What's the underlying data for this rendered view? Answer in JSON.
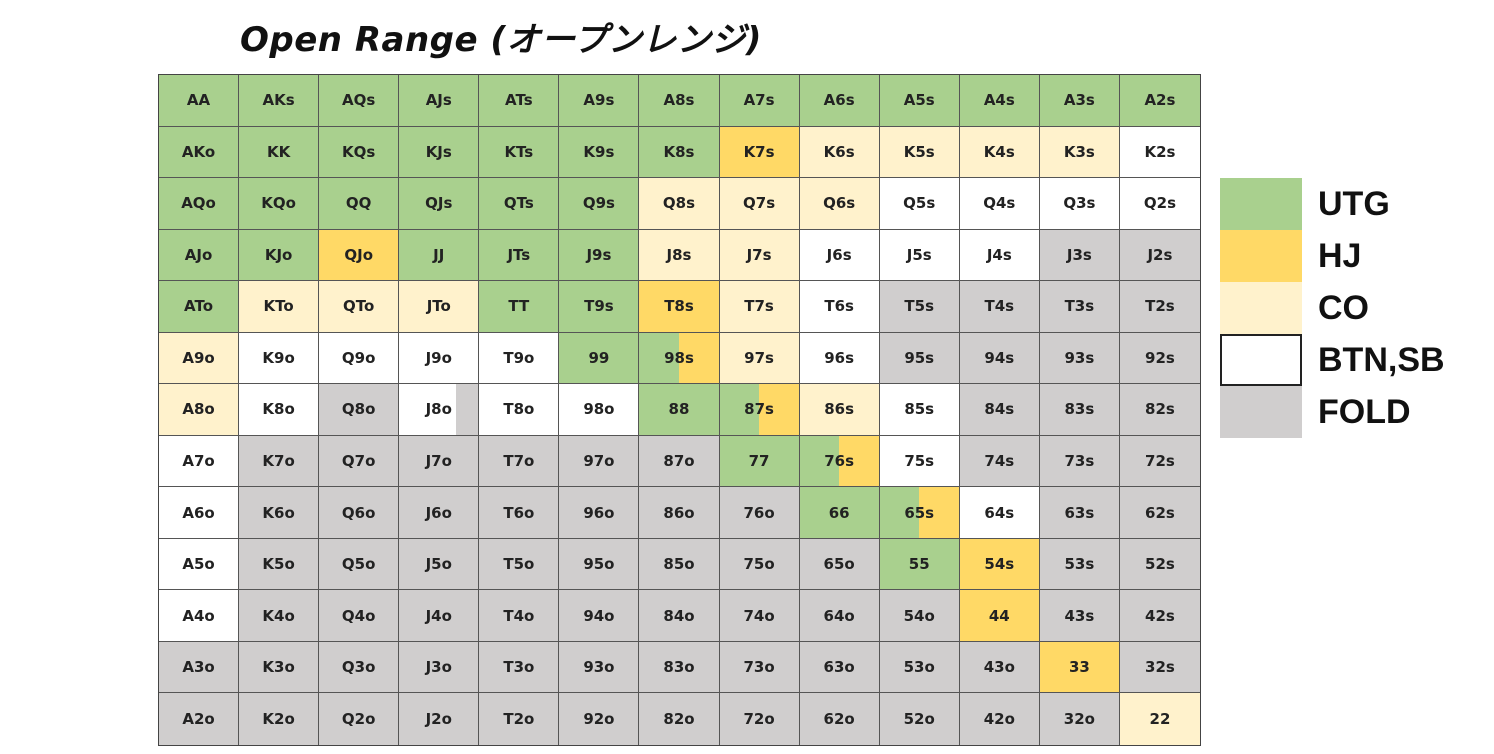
{
  "title": "Open Range (オープンレンジ)",
  "colors": {
    "UTG": "#a9d08e",
    "HJ": "#ffd966",
    "CO": "#fff2cc",
    "BTN": "#ffffff",
    "FOLD": "#d0cece"
  },
  "legend": [
    {
      "label": "UTG",
      "color": "UTG"
    },
    {
      "label": "HJ",
      "color": "HJ"
    },
    {
      "label": "CO",
      "color": "CO"
    },
    {
      "label": "BTN,SB",
      "color": "BTN"
    },
    {
      "label": "FOLD",
      "color": "FOLD"
    }
  ],
  "grid": [
    [
      [
        "AA",
        "UTG"
      ],
      [
        "AKs",
        "UTG"
      ],
      [
        "AQs",
        "UTG"
      ],
      [
        "AJs",
        "UTG"
      ],
      [
        "ATs",
        "UTG"
      ],
      [
        "A9s",
        "UTG"
      ],
      [
        "A8s",
        "UTG"
      ],
      [
        "A7s",
        "UTG"
      ],
      [
        "A6s",
        "UTG"
      ],
      [
        "A5s",
        "UTG"
      ],
      [
        "A4s",
        "UTG"
      ],
      [
        "A3s",
        "UTG"
      ],
      [
        "A2s",
        "UTG"
      ]
    ],
    [
      [
        "AKo",
        "UTG"
      ],
      [
        "KK",
        "UTG"
      ],
      [
        "KQs",
        "UTG"
      ],
      [
        "KJs",
        "UTG"
      ],
      [
        "KTs",
        "UTG"
      ],
      [
        "K9s",
        "UTG"
      ],
      [
        "K8s",
        "UTG"
      ],
      [
        "K7s",
        "HJ"
      ],
      [
        "K6s",
        "CO"
      ],
      [
        "K5s",
        "CO"
      ],
      [
        "K4s",
        "CO"
      ],
      [
        "K3s",
        "CO"
      ],
      [
        "K2s",
        "BTN"
      ]
    ],
    [
      [
        "AQo",
        "UTG"
      ],
      [
        "KQo",
        "UTG"
      ],
      [
        "QQ",
        "UTG"
      ],
      [
        "QJs",
        "UTG"
      ],
      [
        "QTs",
        "UTG"
      ],
      [
        "Q9s",
        "UTG"
      ],
      [
        "Q8s",
        "CO"
      ],
      [
        "Q7s",
        "CO"
      ],
      [
        "Q6s",
        "CO"
      ],
      [
        "Q5s",
        "BTN"
      ],
      [
        "Q4s",
        "BTN"
      ],
      [
        "Q3s",
        "BTN"
      ],
      [
        "Q2s",
        "BTN"
      ]
    ],
    [
      [
        "AJo",
        "UTG"
      ],
      [
        "KJo",
        "UTG"
      ],
      [
        "QJo",
        "HJ"
      ],
      [
        "JJ",
        "UTG"
      ],
      [
        "JTs",
        "UTG"
      ],
      [
        "J9s",
        "UTG"
      ],
      [
        "J8s",
        "CO"
      ],
      [
        "J7s",
        "CO"
      ],
      [
        "J6s",
        "BTN"
      ],
      [
        "J5s",
        "BTN"
      ],
      [
        "J4s",
        "BTN"
      ],
      [
        "J3s",
        "FOLD"
      ],
      [
        "J2s",
        "FOLD"
      ]
    ],
    [
      [
        "ATo",
        "UTG"
      ],
      [
        "KTo",
        "CO"
      ],
      [
        "QTo",
        "CO"
      ],
      [
        "JTo",
        "CO"
      ],
      [
        "TT",
        "UTG"
      ],
      [
        "T9s",
        "UTG"
      ],
      [
        "T8s",
        "HJ"
      ],
      [
        "T7s",
        "CO"
      ],
      [
        "T6s",
        "BTN"
      ],
      [
        "T5s",
        "FOLD"
      ],
      [
        "T4s",
        "FOLD"
      ],
      [
        "T3s",
        "FOLD"
      ],
      [
        "T2s",
        "FOLD"
      ]
    ],
    [
      [
        "A9o",
        "CO"
      ],
      [
        "K9o",
        "BTN"
      ],
      [
        "Q9o",
        "BTN"
      ],
      [
        "J9o",
        "BTN"
      ],
      [
        "T9o",
        "BTN"
      ],
      [
        "99",
        "UTG"
      ],
      [
        "98s",
        "UTG",
        "HJ",
        "half"
      ],
      [
        "97s",
        "CO"
      ],
      [
        "96s",
        "BTN"
      ],
      [
        "95s",
        "FOLD"
      ],
      [
        "94s",
        "FOLD"
      ],
      [
        "93s",
        "FOLD"
      ],
      [
        "92s",
        "FOLD"
      ]
    ],
    [
      [
        "A8o",
        "CO"
      ],
      [
        "K8o",
        "BTN"
      ],
      [
        "Q8o",
        "FOLD"
      ],
      [
        "J8o",
        "BTN",
        "FOLD",
        "third"
      ],
      [
        "T8o",
        "BTN"
      ],
      [
        "98o",
        "BTN"
      ],
      [
        "88",
        "UTG"
      ],
      [
        "87s",
        "UTG",
        "HJ",
        "half"
      ],
      [
        "86s",
        "CO"
      ],
      [
        "85s",
        "BTN"
      ],
      [
        "84s",
        "FOLD"
      ],
      [
        "83s",
        "FOLD"
      ],
      [
        "82s",
        "FOLD"
      ]
    ],
    [
      [
        "A7o",
        "BTN"
      ],
      [
        "K7o",
        "FOLD"
      ],
      [
        "Q7o",
        "FOLD"
      ],
      [
        "J7o",
        "FOLD"
      ],
      [
        "T7o",
        "FOLD"
      ],
      [
        "97o",
        "FOLD"
      ],
      [
        "87o",
        "FOLD"
      ],
      [
        "77",
        "UTG"
      ],
      [
        "76s",
        "UTG",
        "HJ",
        "half"
      ],
      [
        "75s",
        "BTN"
      ],
      [
        "74s",
        "FOLD"
      ],
      [
        "73s",
        "FOLD"
      ],
      [
        "72s",
        "FOLD"
      ]
    ],
    [
      [
        "A6o",
        "BTN"
      ],
      [
        "K6o",
        "FOLD"
      ],
      [
        "Q6o",
        "FOLD"
      ],
      [
        "J6o",
        "FOLD"
      ],
      [
        "T6o",
        "FOLD"
      ],
      [
        "96o",
        "FOLD"
      ],
      [
        "86o",
        "FOLD"
      ],
      [
        "76o",
        "FOLD"
      ],
      [
        "66",
        "UTG"
      ],
      [
        "65s",
        "UTG",
        "HJ",
        "half"
      ],
      [
        "64s",
        "BTN"
      ],
      [
        "63s",
        "FOLD"
      ],
      [
        "62s",
        "FOLD"
      ]
    ],
    [
      [
        "A5o",
        "BTN"
      ],
      [
        "K5o",
        "FOLD"
      ],
      [
        "Q5o",
        "FOLD"
      ],
      [
        "J5o",
        "FOLD"
      ],
      [
        "T5o",
        "FOLD"
      ],
      [
        "95o",
        "FOLD"
      ],
      [
        "85o",
        "FOLD"
      ],
      [
        "75o",
        "FOLD"
      ],
      [
        "65o",
        "FOLD"
      ],
      [
        "55",
        "UTG"
      ],
      [
        "54s",
        "HJ"
      ],
      [
        "53s",
        "FOLD"
      ],
      [
        "52s",
        "FOLD"
      ]
    ],
    [
      [
        "A4o",
        "BTN"
      ],
      [
        "K4o",
        "FOLD"
      ],
      [
        "Q4o",
        "FOLD"
      ],
      [
        "J4o",
        "FOLD"
      ],
      [
        "T4o",
        "FOLD"
      ],
      [
        "94o",
        "FOLD"
      ],
      [
        "84o",
        "FOLD"
      ],
      [
        "74o",
        "FOLD"
      ],
      [
        "64o",
        "FOLD"
      ],
      [
        "54o",
        "FOLD"
      ],
      [
        "44",
        "HJ"
      ],
      [
        "43s",
        "FOLD"
      ],
      [
        "42s",
        "FOLD"
      ]
    ],
    [
      [
        "A3o",
        "FOLD"
      ],
      [
        "K3o",
        "FOLD"
      ],
      [
        "Q3o",
        "FOLD"
      ],
      [
        "J3o",
        "FOLD"
      ],
      [
        "T3o",
        "FOLD"
      ],
      [
        "93o",
        "FOLD"
      ],
      [
        "83o",
        "FOLD"
      ],
      [
        "73o",
        "FOLD"
      ],
      [
        "63o",
        "FOLD"
      ],
      [
        "53o",
        "FOLD"
      ],
      [
        "43o",
        "FOLD"
      ],
      [
        "33",
        "HJ"
      ],
      [
        "32s",
        "FOLD"
      ]
    ],
    [
      [
        "A2o",
        "FOLD"
      ],
      [
        "K2o",
        "FOLD"
      ],
      [
        "Q2o",
        "FOLD"
      ],
      [
        "J2o",
        "FOLD"
      ],
      [
        "T2o",
        "FOLD"
      ],
      [
        "92o",
        "FOLD"
      ],
      [
        "82o",
        "FOLD"
      ],
      [
        "72o",
        "FOLD"
      ],
      [
        "62o",
        "FOLD"
      ],
      [
        "52o",
        "FOLD"
      ],
      [
        "42o",
        "FOLD"
      ],
      [
        "32o",
        "FOLD"
      ],
      [
        "22",
        "CO"
      ]
    ]
  ]
}
